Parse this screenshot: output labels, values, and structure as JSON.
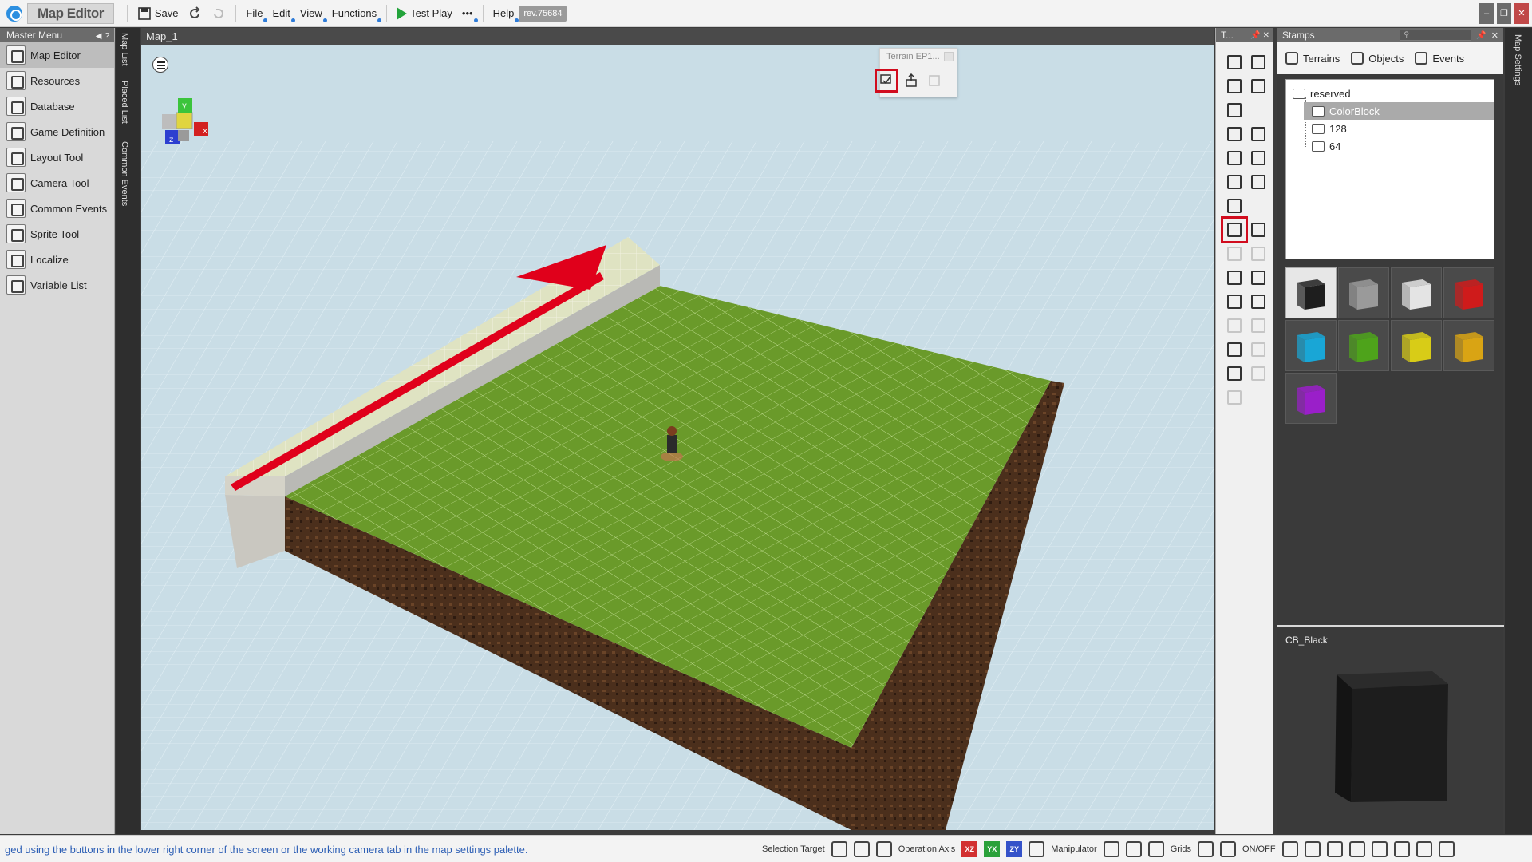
{
  "topbar": {
    "app_title": "Map Editor",
    "save": "Save",
    "menus": [
      "File",
      "Edit",
      "View",
      "Functions"
    ],
    "test_play": "Test Play",
    "more": "•••",
    "help": "Help",
    "revision": "rev.75684"
  },
  "master_menu": {
    "title": "Master Menu",
    "items": [
      {
        "label": "Map Editor",
        "icon": "map-editor-icon"
      },
      {
        "label": "Resources",
        "icon": "resources-icon"
      },
      {
        "label": "Database",
        "icon": "database-icon"
      },
      {
        "label": "Game Definition",
        "icon": "game-definition-icon"
      },
      {
        "label": "Layout Tool",
        "icon": "layout-tool-icon"
      },
      {
        "label": "Camera Tool",
        "icon": "camera-tool-icon"
      },
      {
        "label": "Common Events",
        "icon": "common-events-icon"
      },
      {
        "label": "Sprite Tool",
        "icon": "sprite-tool-icon"
      },
      {
        "label": "Localize",
        "icon": "localize-icon"
      },
      {
        "label": "Variable List",
        "icon": "variable-list-icon"
      }
    ]
  },
  "side_tabs": [
    "Map List",
    "Placed List",
    "Common Events"
  ],
  "viewport": {
    "tab_title": "Map_1",
    "axis_labels": {
      "x": "x",
      "y": "y",
      "z": "z"
    },
    "floating_toolbar_title": "Terrain EP1..."
  },
  "tools_panel": {
    "title": "T..."
  },
  "stamps": {
    "title": "Stamps",
    "tabs": [
      "Terrains",
      "Objects",
      "Events"
    ],
    "tree": {
      "root": "reserved",
      "children": [
        "ColorBlock",
        "128",
        "64"
      ],
      "selected": "ColorBlock"
    },
    "swatch_colors": [
      "#1e1e1e",
      "#9a9a9a",
      "#e4e4e4",
      "#cf1b1b",
      "#19a6d6",
      "#4ea31b",
      "#d8cc17",
      "#d9a414",
      "#9a1fc9"
    ],
    "preview_label": "CB_Black"
  },
  "map_settings_label": "Map Settings",
  "statusbar": {
    "message": "ged using the buttons in the lower right corner of the screen or the working camera tab in the map settings palette.",
    "selection_target": "Selection Target",
    "operation_axis": "Operation Axis",
    "axes": [
      "XZ",
      "YX",
      "ZY"
    ],
    "axis_colors": [
      "#d23030",
      "#2aa13a",
      "#3452c9"
    ],
    "manipulator": "Manipulator",
    "grids": "Grids",
    "onoff": "ON/OFF"
  },
  "colors": {
    "highlight": "#d10c1e",
    "arrow": "#e0001b",
    "grass": "#6a9a2a",
    "soil": "#4b2f1c",
    "sky": "#c9dde6"
  }
}
